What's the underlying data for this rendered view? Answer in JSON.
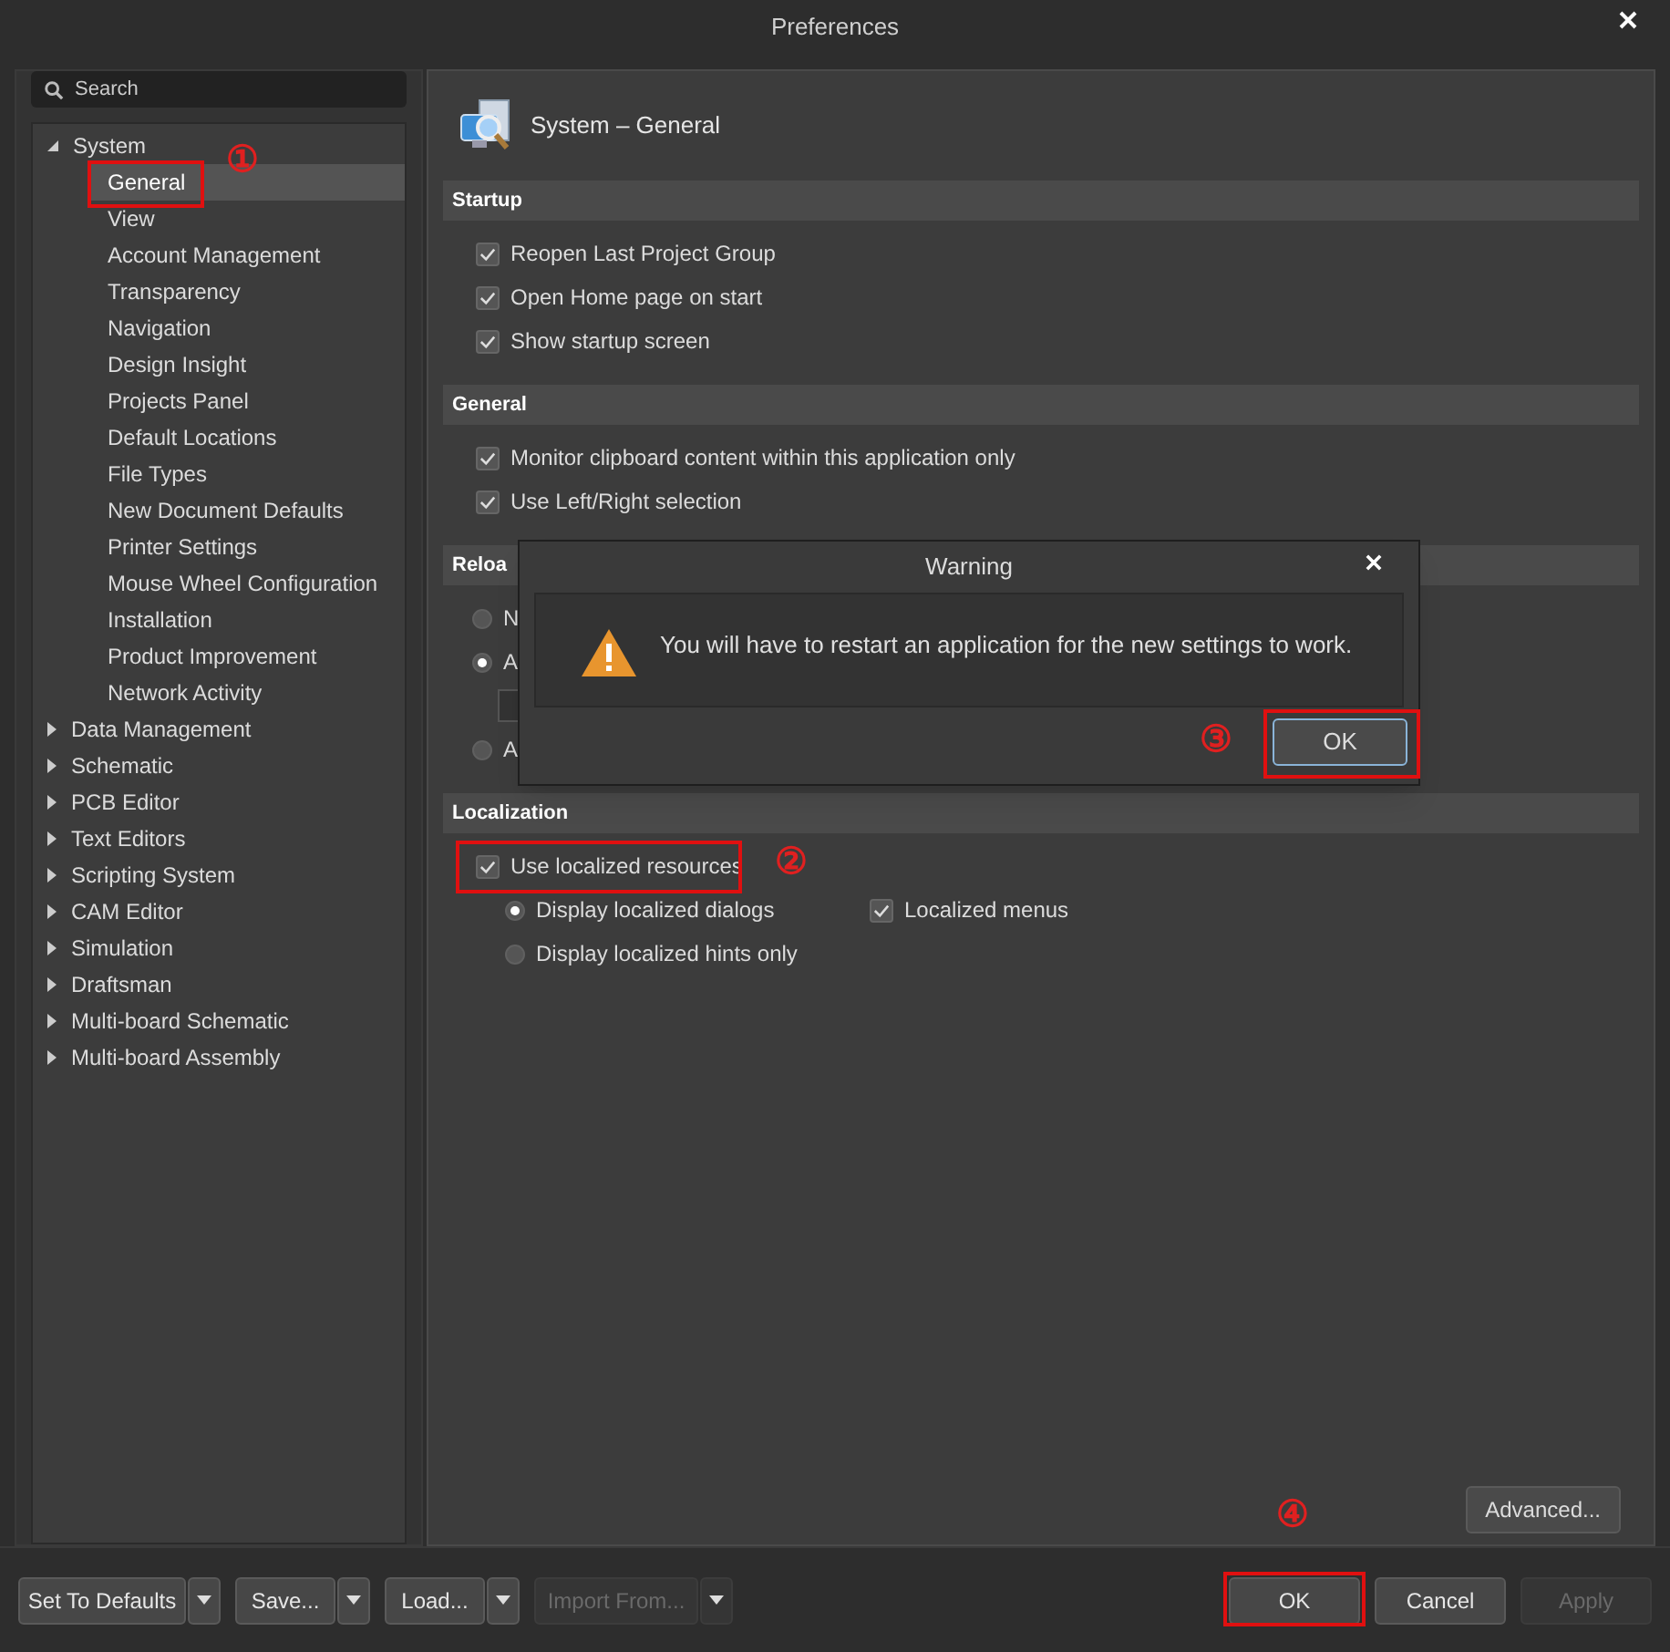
{
  "window": {
    "title": "Preferences"
  },
  "search": {
    "placeholder": "Search"
  },
  "tree": [
    {
      "label": "System",
      "expanded": true,
      "children": [
        {
          "label": "General",
          "selected": true,
          "highlight": true,
          "marker": "①"
        },
        {
          "label": "View",
          "selected": false
        },
        {
          "label": "Account Management",
          "selected": false
        },
        {
          "label": "Transparency",
          "selected": false
        },
        {
          "label": "Navigation",
          "selected": false
        },
        {
          "label": "Design Insight",
          "selected": false
        },
        {
          "label": "Projects Panel",
          "selected": false
        },
        {
          "label": "Default Locations",
          "selected": false
        },
        {
          "label": "File Types",
          "selected": false
        },
        {
          "label": "New Document Defaults",
          "selected": false
        },
        {
          "label": "Printer Settings",
          "selected": false
        },
        {
          "label": "Mouse Wheel Configuration",
          "selected": false
        },
        {
          "label": "Installation",
          "selected": false
        },
        {
          "label": "Product Improvement",
          "selected": false
        },
        {
          "label": "Network Activity",
          "selected": false
        }
      ]
    },
    {
      "label": "Data Management",
      "expanded": false
    },
    {
      "label": "Schematic",
      "expanded": false
    },
    {
      "label": "PCB Editor",
      "expanded": false
    },
    {
      "label": "Text Editors",
      "expanded": false
    },
    {
      "label": "Scripting System",
      "expanded": false
    },
    {
      "label": "CAM Editor",
      "expanded": false
    },
    {
      "label": "Simulation",
      "expanded": false
    },
    {
      "label": "Draftsman",
      "expanded": false
    },
    {
      "label": "Multi-board Schematic",
      "expanded": false
    },
    {
      "label": "Multi-board Assembly",
      "expanded": false
    }
  ],
  "page": {
    "title": "System – General"
  },
  "sections": [
    {
      "title": "Startup",
      "rows": [
        {
          "kind": "checkbox",
          "label": "Reopen Last Project Group",
          "checked": true
        },
        {
          "kind": "checkbox",
          "label": "Open Home page on start",
          "checked": true
        },
        {
          "kind": "checkbox",
          "label": "Show startup screen",
          "checked": true
        }
      ]
    },
    {
      "title": "General",
      "rows": [
        {
          "kind": "checkbox",
          "label": "Monitor clipboard content within this application only",
          "checked": true
        },
        {
          "kind": "checkbox",
          "label": "Use Left/Right selection",
          "checked": true
        }
      ]
    },
    {
      "title": "Reloa",
      "rows": [
        {
          "kind": "radio",
          "label": "N",
          "selected": false
        },
        {
          "kind": "radio",
          "label": "A",
          "selected": true
        },
        {
          "kind": "field"
        },
        {
          "kind": "radio",
          "label": "A",
          "selected": false
        }
      ]
    },
    {
      "title": "Localization",
      "rows": [
        {
          "kind": "checkbox",
          "label": "Use localized resources",
          "checked": true,
          "highlight": true,
          "marker": "②"
        },
        {
          "kind": "pair",
          "left": {
            "kind": "radio",
            "label": "Display localized dialogs",
            "selected": true
          },
          "right": {
            "kind": "checkbox",
            "label": "Localized menus",
            "checked": true
          }
        },
        {
          "kind": "radio-indented",
          "label": "Display localized hints only",
          "selected": false
        }
      ]
    }
  ],
  "advanced_button": "Advanced...",
  "footer_left": [
    {
      "label": "Set To Defaults",
      "disabled": false
    },
    {
      "label": "Save...",
      "disabled": false
    },
    {
      "label": "Load...",
      "disabled": false
    },
    {
      "label": "Import From...",
      "disabled": true
    }
  ],
  "footer_right": [
    {
      "label": "OK",
      "disabled": false,
      "highlight": true,
      "marker": "④"
    },
    {
      "label": "Cancel",
      "disabled": false
    },
    {
      "label": "Apply",
      "disabled": true
    }
  ],
  "dialog": {
    "title": "Warning",
    "message": "You will have to restart an application for the new settings to work.",
    "button": {
      "label": "OK",
      "highlight": true,
      "marker": "③"
    }
  }
}
